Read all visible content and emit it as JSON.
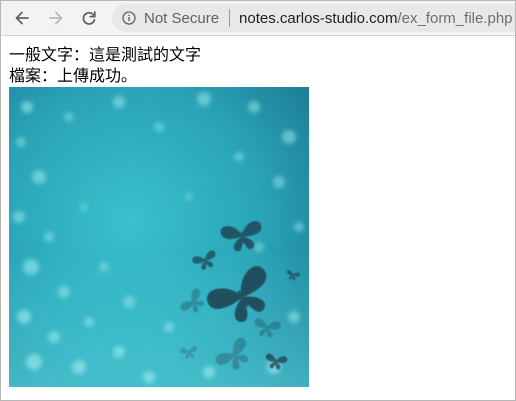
{
  "browser": {
    "security_label": "Not Secure",
    "url_host": "notes.carlos-studio.com",
    "url_path": "/ex_form_file.php",
    "icons": {
      "back": "arrow-left-icon",
      "forward": "arrow-right-icon",
      "reload": "reload-icon",
      "info": "info-icon"
    }
  },
  "page": {
    "text_line": "一般文字：這是測試的文字",
    "file_line": "檔案：上傳成功。",
    "image": {
      "description_colors": {
        "background_light": "#5fd4dc",
        "background_dark": "#1a6f86",
        "butterfly": "#1e4756"
      }
    }
  }
}
